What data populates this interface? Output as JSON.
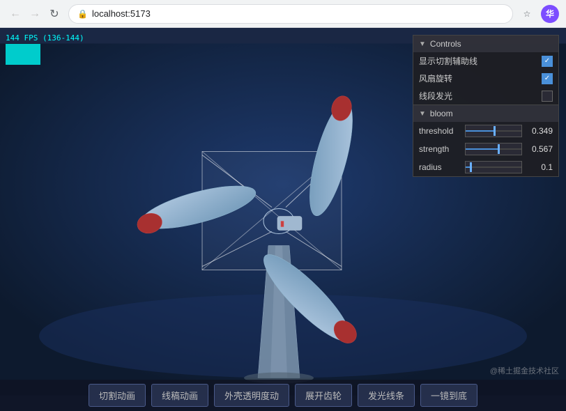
{
  "browser": {
    "url": "localhost:5173",
    "avatar_text": "华"
  },
  "fps": {
    "label": "144 FPS (136-144)"
  },
  "controls": {
    "section_title": "Controls",
    "row1_label": "显示切割辅助线",
    "row1_checked": true,
    "row2_label": "风扇旋转",
    "row2_checked": true,
    "row3_label": "线段发光",
    "row3_checked": false,
    "bloom_title": "bloom",
    "threshold_label": "threshold",
    "threshold_value": "0.349",
    "threshold_pct": 52,
    "strength_label": "strength",
    "strength_value": "0.567",
    "strength_pct": 60,
    "radius_label": "radius",
    "radius_value": "0.1",
    "radius_pct": 10
  },
  "buttons": [
    {
      "label": "切割动画"
    },
    {
      "label": "线稿动画"
    },
    {
      "label": "外壳透明度动"
    },
    {
      "label": "展开齿轮"
    },
    {
      "label": "发光线条"
    },
    {
      "label": "一镜到底"
    }
  ],
  "watermark": {
    "text": "@稀土掘金技术社区"
  }
}
